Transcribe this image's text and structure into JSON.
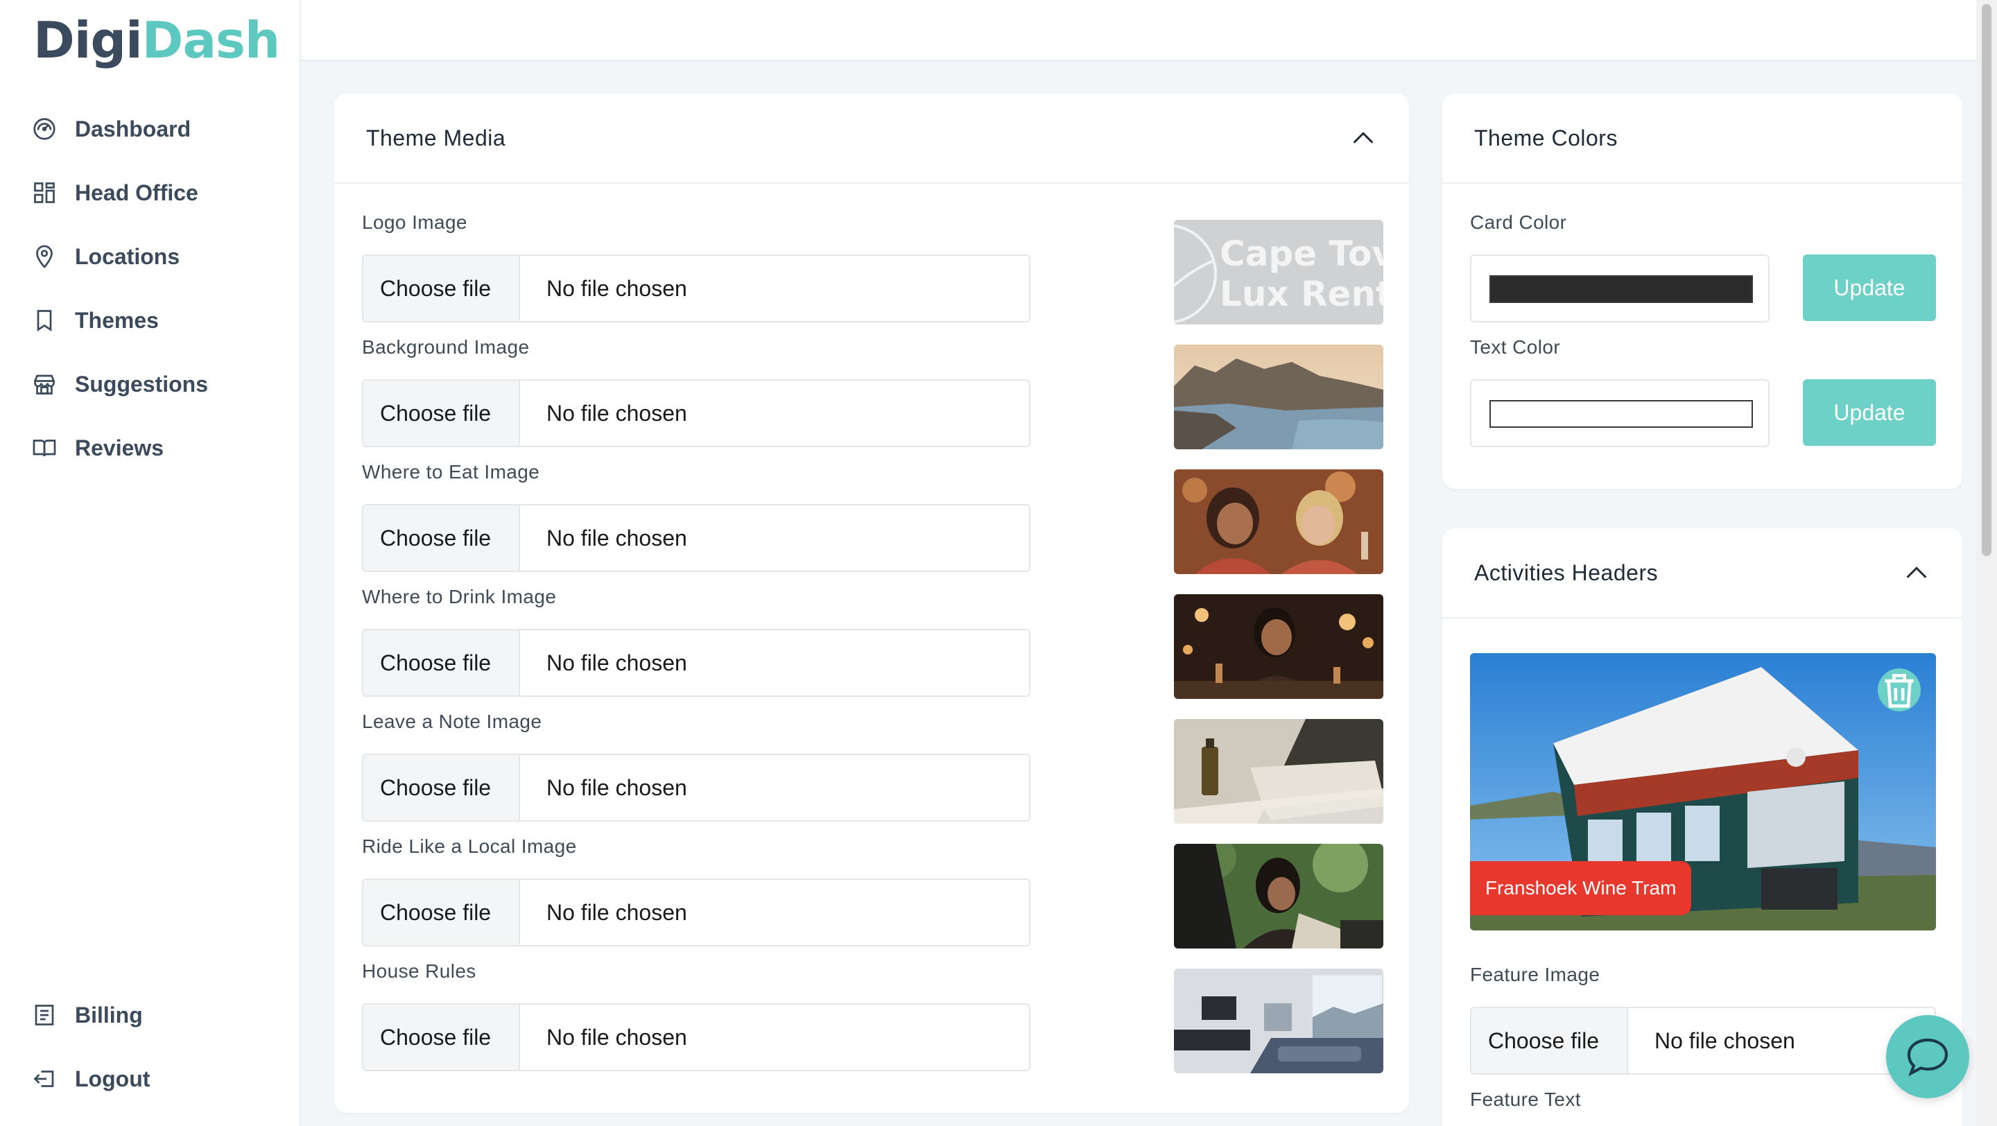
{
  "brand": {
    "part1": "Digi",
    "part2": "Dash"
  },
  "nav": {
    "items": [
      {
        "label": "Dashboard",
        "icon": "gauge-icon"
      },
      {
        "label": "Head Office",
        "icon": "grid-icon"
      },
      {
        "label": "Locations",
        "icon": "map-pin-icon"
      },
      {
        "label": "Themes",
        "icon": "bookmark-icon"
      },
      {
        "label": "Suggestions",
        "icon": "store-icon"
      },
      {
        "label": "Reviews",
        "icon": "book-icon"
      }
    ],
    "bottom": [
      {
        "label": "Billing",
        "icon": "receipt-icon"
      },
      {
        "label": "Logout",
        "icon": "logout-icon"
      }
    ]
  },
  "theme_media": {
    "title": "Theme Media",
    "fields": [
      {
        "label": "Logo Image",
        "button": "Choose file",
        "status": "No file chosen",
        "preview_text": [
          "Cape Tov",
          "Lux Rent"
        ]
      },
      {
        "label": "Background Image",
        "button": "Choose file",
        "status": "No file chosen"
      },
      {
        "label": "Where to Eat Image",
        "button": "Choose file",
        "status": "No file chosen"
      },
      {
        "label": "Where to Drink Image",
        "button": "Choose file",
        "status": "No file chosen"
      },
      {
        "label": "Leave a Note Image",
        "button": "Choose file",
        "status": "No file chosen"
      },
      {
        "label": "Ride Like a Local Image",
        "button": "Choose file",
        "status": "No file chosen"
      },
      {
        "label": "House Rules",
        "button": "Choose file",
        "status": "No file chosen"
      }
    ]
  },
  "theme_colors": {
    "title": "Theme Colors",
    "card_color": {
      "label": "Card Color",
      "value": "#2b2b2b",
      "button": "Update"
    },
    "text_color": {
      "label": "Text Color",
      "value": "#ffffff",
      "button": "Update"
    }
  },
  "activities": {
    "title": "Activities Headers",
    "feature_tag": "Franshoek Wine Tram",
    "feature_image_label": "Feature Image",
    "feature_button": "Choose file",
    "feature_status": "No file chosen",
    "feature_text_label": "Feature Text"
  },
  "colors": {
    "accent": "#5cc8c0",
    "button": "#6ed1c7",
    "tag": "#e8382e",
    "nav_text": "#3b4a5c"
  }
}
